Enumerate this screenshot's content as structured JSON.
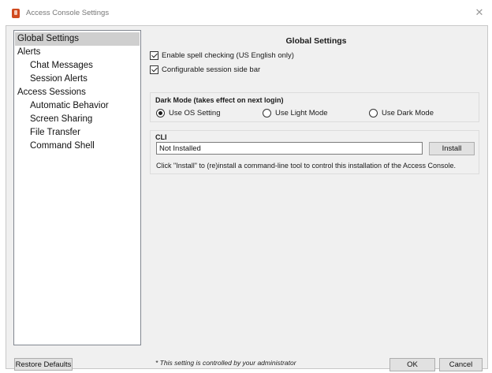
{
  "window": {
    "title": "Access Console Settings",
    "close_glyph": "✕",
    "icon": "app-icon"
  },
  "nav": {
    "items": [
      {
        "label": "Global Settings",
        "level": 0,
        "selected": true
      },
      {
        "label": "Alerts",
        "level": 0,
        "selected": false
      },
      {
        "label": "Chat Messages",
        "level": 1,
        "selected": false
      },
      {
        "label": "Session Alerts",
        "level": 1,
        "selected": false
      },
      {
        "label": "Access Sessions",
        "level": 0,
        "selected": false
      },
      {
        "label": "Automatic Behavior",
        "level": 1,
        "selected": false
      },
      {
        "label": "Screen Sharing",
        "level": 1,
        "selected": false
      },
      {
        "label": "File Transfer",
        "level": 1,
        "selected": false
      },
      {
        "label": "Command Shell",
        "level": 1,
        "selected": false
      }
    ]
  },
  "main": {
    "title": "Global Settings",
    "spell_check": {
      "label": "Enable spell checking (US English only)",
      "checked": true
    },
    "side_bar": {
      "label": "Configurable session side bar",
      "checked": true
    },
    "dark_mode": {
      "label": "Dark Mode (takes effect on next login)",
      "options": [
        {
          "label": "Use OS Setting",
          "selected": true
        },
        {
          "label": "Use Light Mode",
          "selected": false
        },
        {
          "label": "Use Dark Mode",
          "selected": false
        }
      ]
    },
    "cli": {
      "label": "CLI",
      "status_value": "Not Installed",
      "install_label": "Install",
      "help_text": "Click \"Install\" to (re)install a command-line tool to control this installation of the Access Console."
    }
  },
  "footer": {
    "restore_label": "Restore Defaults",
    "note": "* This setting is controlled by your administrator",
    "ok_label": "OK",
    "cancel_label": "Cancel"
  },
  "colors": {
    "selection": "#cfcfcf",
    "panel_background": "#f0f0f0",
    "app_icon": "#d04a1f"
  }
}
